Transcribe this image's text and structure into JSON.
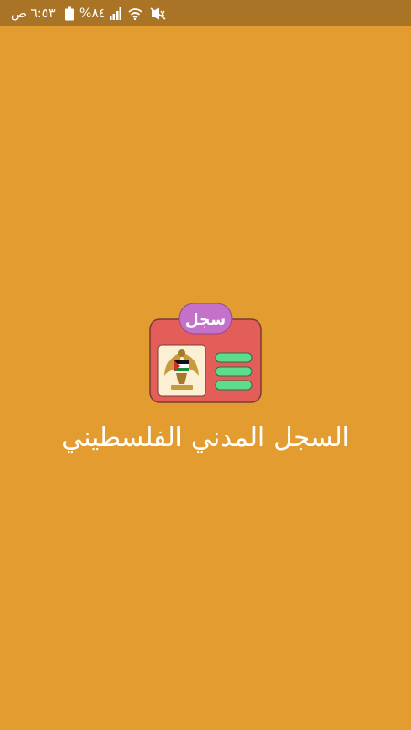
{
  "status_bar": {
    "time": "٦:٥٣ ص",
    "battery": "%٨٤",
    "icons": [
      "battery-icon",
      "signal-icon",
      "wifi-icon",
      "mute-icon"
    ]
  },
  "splash": {
    "logo": {
      "tag_label": "سجل",
      "icon": "palestinian-eagle-emblem-icon",
      "colors": {
        "card": "#e35d59",
        "tag": "#c371c9",
        "bars": "#5ddc8d",
        "emblem_bg": "#fbf0d4"
      }
    },
    "title": "السجل المدني الفلسطيني"
  },
  "colors": {
    "background": "#e39c2f",
    "status_bar": "#a97426",
    "text": "#ffffff"
  }
}
